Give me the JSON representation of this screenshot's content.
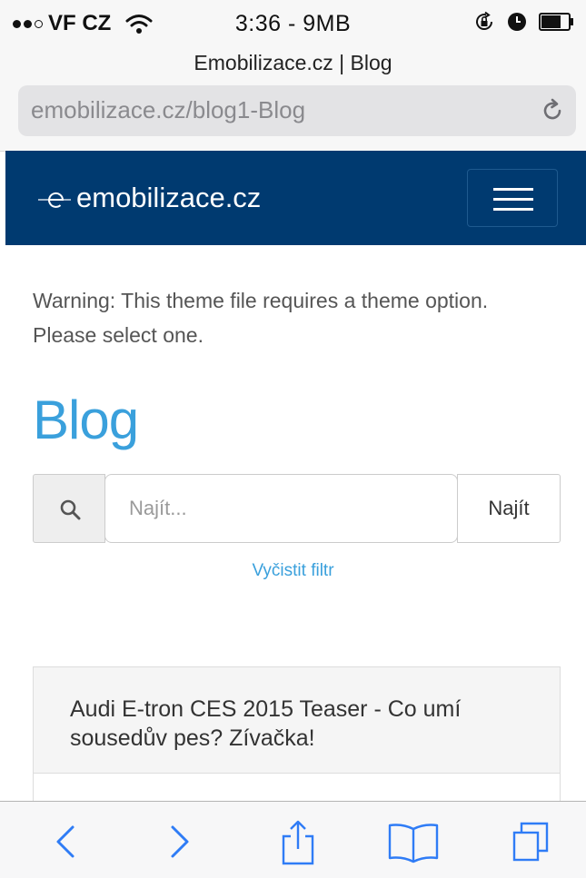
{
  "status_bar": {
    "carrier": "VF CZ",
    "time": "3:36 - 9MB"
  },
  "browser": {
    "page_title": "Emobilizace.cz | Blog",
    "url": "emobilizace.cz/blog1-Blog"
  },
  "site": {
    "brand": "emobilizace.cz",
    "header_color": "#003a70"
  },
  "content": {
    "warning": "Warning: This theme file requires a theme option. Please select one.",
    "title": "Blog",
    "title_color": "#3aa0dc",
    "search": {
      "placeholder": "Najít...",
      "value": "",
      "button_label": "Najít"
    },
    "clear_filter": "Vyčistit filtr",
    "posts": [
      {
        "title": "Audi E-tron CES 2015 Teaser - Co umí sousedův pes? Zívačka!"
      }
    ]
  },
  "toolbar": {
    "accent": "#2f7cf6",
    "icons": [
      "back-icon",
      "forward-icon",
      "share-icon",
      "bookmarks-icon",
      "tabs-icon"
    ]
  }
}
